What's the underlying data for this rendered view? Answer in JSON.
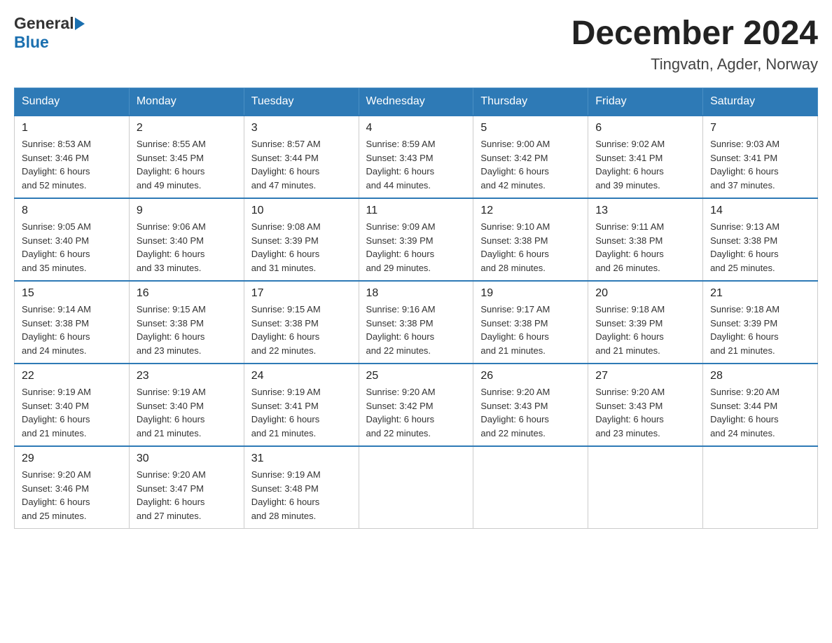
{
  "header": {
    "logo_general": "General",
    "logo_blue": "Blue",
    "month_title": "December 2024",
    "location": "Tingvatn, Agder, Norway"
  },
  "days_of_week": [
    "Sunday",
    "Monday",
    "Tuesday",
    "Wednesday",
    "Thursday",
    "Friday",
    "Saturday"
  ],
  "weeks": [
    [
      {
        "day": "1",
        "sunrise": "8:53 AM",
        "sunset": "3:46 PM",
        "daylight": "6 hours and 52 minutes."
      },
      {
        "day": "2",
        "sunrise": "8:55 AM",
        "sunset": "3:45 PM",
        "daylight": "6 hours and 49 minutes."
      },
      {
        "day": "3",
        "sunrise": "8:57 AM",
        "sunset": "3:44 PM",
        "daylight": "6 hours and 47 minutes."
      },
      {
        "day": "4",
        "sunrise": "8:59 AM",
        "sunset": "3:43 PM",
        "daylight": "6 hours and 44 minutes."
      },
      {
        "day": "5",
        "sunrise": "9:00 AM",
        "sunset": "3:42 PM",
        "daylight": "6 hours and 42 minutes."
      },
      {
        "day": "6",
        "sunrise": "9:02 AM",
        "sunset": "3:41 PM",
        "daylight": "6 hours and 39 minutes."
      },
      {
        "day": "7",
        "sunrise": "9:03 AM",
        "sunset": "3:41 PM",
        "daylight": "6 hours and 37 minutes."
      }
    ],
    [
      {
        "day": "8",
        "sunrise": "9:05 AM",
        "sunset": "3:40 PM",
        "daylight": "6 hours and 35 minutes."
      },
      {
        "day": "9",
        "sunrise": "9:06 AM",
        "sunset": "3:40 PM",
        "daylight": "6 hours and 33 minutes."
      },
      {
        "day": "10",
        "sunrise": "9:08 AM",
        "sunset": "3:39 PM",
        "daylight": "6 hours and 31 minutes."
      },
      {
        "day": "11",
        "sunrise": "9:09 AM",
        "sunset": "3:39 PM",
        "daylight": "6 hours and 29 minutes."
      },
      {
        "day": "12",
        "sunrise": "9:10 AM",
        "sunset": "3:38 PM",
        "daylight": "6 hours and 28 minutes."
      },
      {
        "day": "13",
        "sunrise": "9:11 AM",
        "sunset": "3:38 PM",
        "daylight": "6 hours and 26 minutes."
      },
      {
        "day": "14",
        "sunrise": "9:13 AM",
        "sunset": "3:38 PM",
        "daylight": "6 hours and 25 minutes."
      }
    ],
    [
      {
        "day": "15",
        "sunrise": "9:14 AM",
        "sunset": "3:38 PM",
        "daylight": "6 hours and 24 minutes."
      },
      {
        "day": "16",
        "sunrise": "9:15 AM",
        "sunset": "3:38 PM",
        "daylight": "6 hours and 23 minutes."
      },
      {
        "day": "17",
        "sunrise": "9:15 AM",
        "sunset": "3:38 PM",
        "daylight": "6 hours and 22 minutes."
      },
      {
        "day": "18",
        "sunrise": "9:16 AM",
        "sunset": "3:38 PM",
        "daylight": "6 hours and 22 minutes."
      },
      {
        "day": "19",
        "sunrise": "9:17 AM",
        "sunset": "3:38 PM",
        "daylight": "6 hours and 21 minutes."
      },
      {
        "day": "20",
        "sunrise": "9:18 AM",
        "sunset": "3:39 PM",
        "daylight": "6 hours and 21 minutes."
      },
      {
        "day": "21",
        "sunrise": "9:18 AM",
        "sunset": "3:39 PM",
        "daylight": "6 hours and 21 minutes."
      }
    ],
    [
      {
        "day": "22",
        "sunrise": "9:19 AM",
        "sunset": "3:40 PM",
        "daylight": "6 hours and 21 minutes."
      },
      {
        "day": "23",
        "sunrise": "9:19 AM",
        "sunset": "3:40 PM",
        "daylight": "6 hours and 21 minutes."
      },
      {
        "day": "24",
        "sunrise": "9:19 AM",
        "sunset": "3:41 PM",
        "daylight": "6 hours and 21 minutes."
      },
      {
        "day": "25",
        "sunrise": "9:20 AM",
        "sunset": "3:42 PM",
        "daylight": "6 hours and 22 minutes."
      },
      {
        "day": "26",
        "sunrise": "9:20 AM",
        "sunset": "3:43 PM",
        "daylight": "6 hours and 22 minutes."
      },
      {
        "day": "27",
        "sunrise": "9:20 AM",
        "sunset": "3:43 PM",
        "daylight": "6 hours and 23 minutes."
      },
      {
        "day": "28",
        "sunrise": "9:20 AM",
        "sunset": "3:44 PM",
        "daylight": "6 hours and 24 minutes."
      }
    ],
    [
      {
        "day": "29",
        "sunrise": "9:20 AM",
        "sunset": "3:46 PM",
        "daylight": "6 hours and 25 minutes."
      },
      {
        "day": "30",
        "sunrise": "9:20 AM",
        "sunset": "3:47 PM",
        "daylight": "6 hours and 27 minutes."
      },
      {
        "day": "31",
        "sunrise": "9:19 AM",
        "sunset": "3:48 PM",
        "daylight": "6 hours and 28 minutes."
      },
      null,
      null,
      null,
      null
    ]
  ],
  "labels": {
    "sunrise": "Sunrise:",
    "sunset": "Sunset:",
    "daylight": "Daylight:"
  },
  "colors": {
    "header_bg": "#2e7ab6",
    "border_accent": "#2e7ab6"
  }
}
